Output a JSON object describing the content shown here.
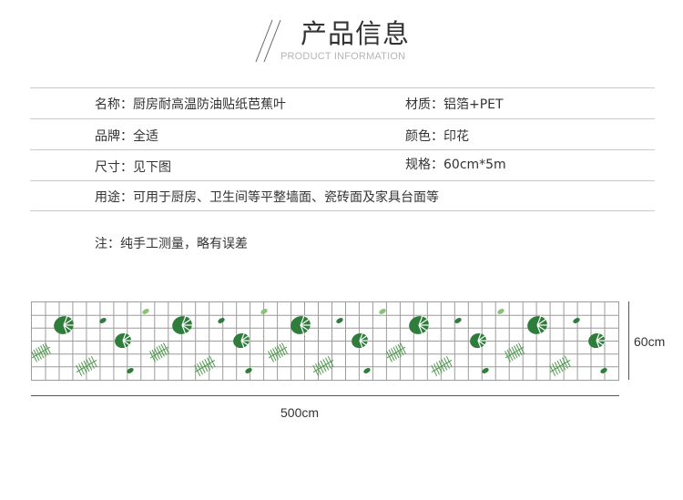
{
  "header": {
    "title": "产品信息",
    "subtitle": "PRODUCT INFORMATION"
  },
  "specs": {
    "name": "名称：厨房耐高温防油贴纸芭蕉叶",
    "material": "材质：铝箔+PET",
    "brand": "品牌：全适",
    "color": "颜色：印花",
    "size": "尺寸：见下图",
    "dimensions": "规格：60cm*5m",
    "usage": "用途：可用于厨房、卫生间等平整墙面、瓷砖面及家具台面等"
  },
  "note": "注：纯手工测量，略有误差",
  "diagram": {
    "height_label": "60cm",
    "width_label": "500cm",
    "line_color": "#9c9c9c",
    "leaf_colors": [
      "#2e7d3a",
      "#4c9a4a",
      "#8bc27a"
    ]
  }
}
